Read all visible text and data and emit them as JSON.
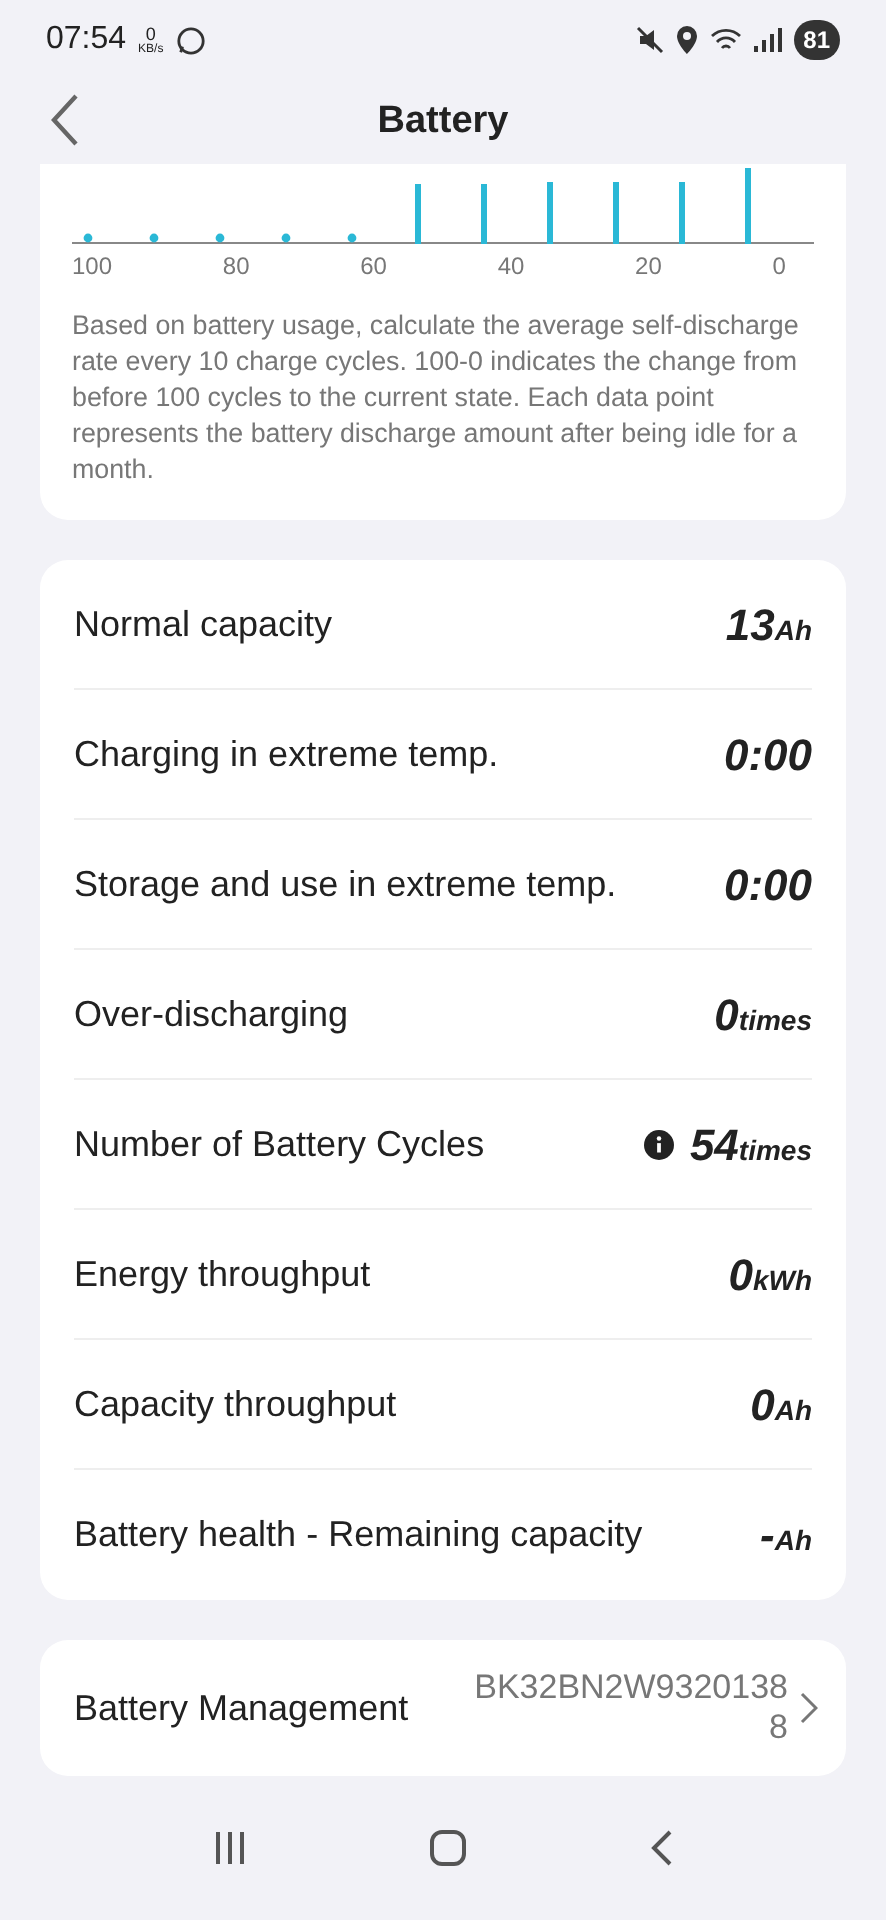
{
  "status_bar": {
    "time": "07:54",
    "speed_value": "0",
    "speed_unit": "KB/s",
    "battery": "81"
  },
  "header": {
    "title": "Battery"
  },
  "chart_card": {
    "x_labels": [
      "100",
      "80",
      "60",
      "40",
      "20",
      "0"
    ],
    "description": "Based on battery usage, calculate the average self-discharge rate every 10 charge cycles. 100-0 indicates the change from before 100 cycles to the current state. Each data point represents the battery discharge amount after being idle for a month."
  },
  "metrics": [
    {
      "label": "Normal capacity",
      "value": "13",
      "unit": "Ah",
      "info": false
    },
    {
      "label": "Charging in extreme temp.",
      "value": "0:00",
      "info": false
    },
    {
      "label": "Storage and use in extreme temp.",
      "value": "0:00",
      "info": false
    },
    {
      "label": "Over-discharging",
      "value": "0",
      "unit": "times",
      "info": false
    },
    {
      "label": "Number of Battery Cycles",
      "value": "54",
      "unit": "times",
      "info": true
    },
    {
      "label": "Energy throughput",
      "value": "0",
      "unit": "kWh",
      "info": false
    },
    {
      "label": "Capacity throughput",
      "value": "0",
      "unit": "Ah",
      "info": false
    },
    {
      "label": "Battery health - Remaining capacity",
      "value": "-",
      "unit": "Ah",
      "info": false
    }
  ],
  "management": {
    "label": "Battery Management",
    "serial": "BK32BN2W93201388"
  }
}
